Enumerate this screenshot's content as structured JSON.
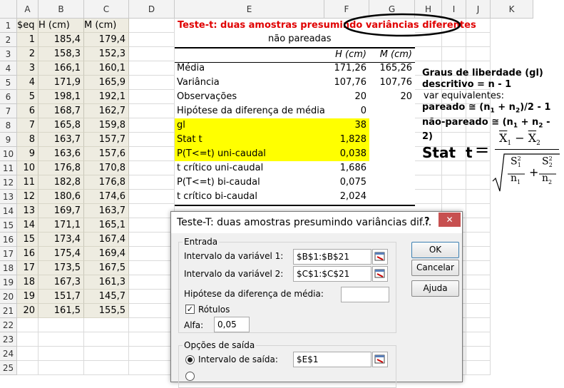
{
  "columns": [
    "A",
    "B",
    "C",
    "D",
    "E",
    "F",
    "G",
    "H",
    "I",
    "J",
    "K"
  ],
  "rows": [
    "1",
    "2",
    "3",
    "4",
    "5",
    "6",
    "7",
    "8",
    "9",
    "10",
    "11",
    "12",
    "13",
    "14",
    "15",
    "16",
    "17",
    "18",
    "19",
    "20",
    "21",
    "22",
    "23",
    "24",
    "25"
  ],
  "headers": {
    "seq": "$eq",
    "h": "H (cm)",
    "m": "M (cm)"
  },
  "seq": [
    "1",
    "2",
    "3",
    "4",
    "5",
    "6",
    "7",
    "8",
    "9",
    "10",
    "11",
    "12",
    "13",
    "14",
    "15",
    "16",
    "17",
    "18",
    "19",
    "20"
  ],
  "h_values": [
    "185,4",
    "158,3",
    "166,1",
    "171,9",
    "198,1",
    "168,7",
    "165,8",
    "163,7",
    "163,6",
    "176,8",
    "182,8",
    "180,6",
    "169,7",
    "171,1",
    "173,4",
    "175,4",
    "173,5",
    "167,3",
    "151,7",
    "161,5"
  ],
  "m_values": [
    "179,4",
    "152,3",
    "160,1",
    "165,9",
    "192,1",
    "162,7",
    "159,8",
    "157,7",
    "157,6",
    "170,8",
    "176,8",
    "174,6",
    "163,7",
    "165,1",
    "167,4",
    "169,4",
    "167,5",
    "161,3",
    "145,7",
    "155,5"
  ],
  "title": "Teste-t: duas amostras presumindo variâncias diferentes",
  "subtitle": "não pareadas",
  "result_headers": {
    "h": "H (cm)",
    "m": "M (cm)"
  },
  "results": [
    {
      "label": "Média",
      "h": "171,26",
      "m": "165,26"
    },
    {
      "label": "Variância",
      "h": "107,76",
      "m": "107,76"
    },
    {
      "label": "Observações",
      "h": "20",
      "m": "20"
    },
    {
      "label": "Hipótese da diferença de média",
      "h": "0",
      "m": ""
    },
    {
      "label": "gl",
      "h": "38",
      "m": ""
    },
    {
      "label": "Stat t",
      "h": "1,828",
      "m": ""
    },
    {
      "label": "P(T<=t) uni-caudal",
      "h": "0,038",
      "m": ""
    },
    {
      "label": "t crítico uni-caudal",
      "h": "1,686",
      "m": ""
    },
    {
      "label": "P(T<=t) bi-caudal",
      "h": "0,075",
      "m": ""
    },
    {
      "label": "t crítico bi-caudal",
      "h": "2,024",
      "m": ""
    }
  ],
  "notes": {
    "line1": "Graus de liberdade (gl)",
    "line2": "descritivo = n - 1",
    "line3": "var equivalentes:",
    "line4a": "pareado ≅ (n",
    "line4b": "1",
    "line4c": " + n",
    "line4d": "2",
    "line4e": ")/2 - 1",
    "line5a": "não-pareado ≅ (n",
    "line5b": "1",
    "line5c": " + n",
    "line5d": "2",
    "line5e": " - 2)"
  },
  "formula": {
    "label": "Stat  t",
    "eq": "=",
    "x1": "X",
    "x1sub": "1",
    "minus": "−",
    "x2": "X",
    "x2sub": "2",
    "s1": "S",
    "s1sup": "2",
    "s1sub": "1",
    "n1": "n",
    "n1sub": "1",
    "plus": "+",
    "s2": "S",
    "s2sup": "2",
    "s2sub": "2",
    "n2": "n",
    "n2sub": "2"
  },
  "dialog": {
    "title": "Teste-T: duas amostras presumindo variâncias dif...",
    "help": "?",
    "close": "✕",
    "section_input": "Entrada",
    "var1_label": "Intervalo da variável 1:",
    "var1_value": "$B$1:$B$21",
    "var2_label": "Intervalo da variável 2:",
    "var2_value": "$C$1:$C$21",
    "hyp_label": "Hipótese da diferença de média:",
    "hyp_value": "",
    "labels_checkbox": "Rótulos",
    "alpha_label": "Alfa:",
    "alpha_value": "0,05",
    "section_output": "Opções de saída",
    "output_range_label": "Intervalo de saída:",
    "output_range_value": "$E$1",
    "ok": "OK",
    "cancel": "Cancelar",
    "help_button": "Ajuda"
  }
}
